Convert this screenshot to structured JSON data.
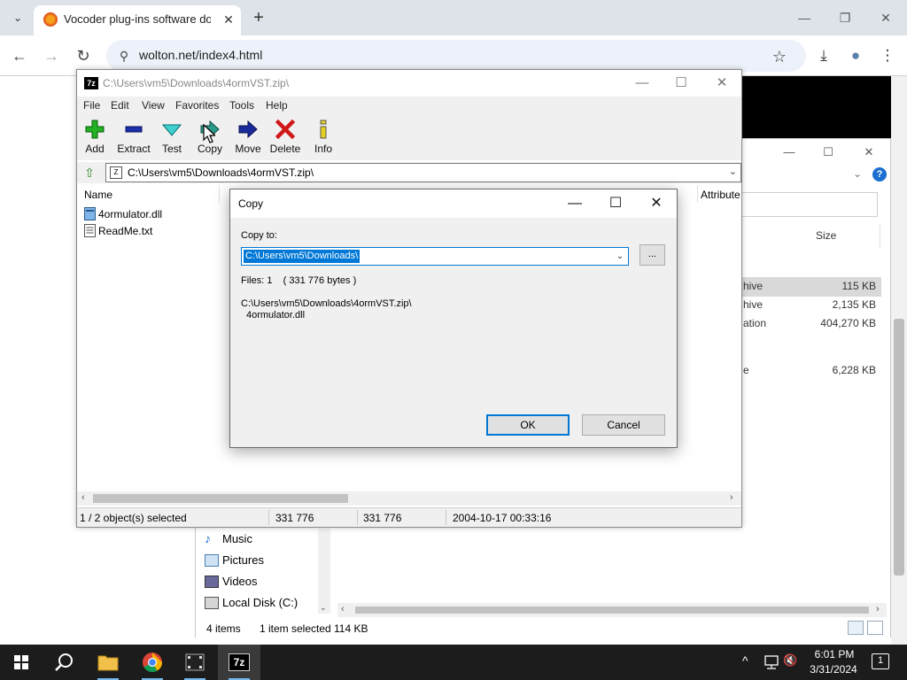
{
  "browser": {
    "tab_title": "Vocoder plug-ins software dow",
    "url": "wolton.net/index4.html",
    "icons": {
      "tab_search": "chevron-down-icon",
      "favicon": "site-favicon-icon",
      "close_tab": "close-icon",
      "new_tab": "plus-icon",
      "back": "back-arrow-icon",
      "forward": "forward-arrow-icon",
      "reload": "reload-icon",
      "site_info": "site-info-icon",
      "bookmark": "star-icon",
      "downloads": "download-icon",
      "profile": "profile-icon",
      "menu": "more-vert-icon"
    },
    "glyphs": {
      "tab_search": "⌄",
      "close_tab": "✕",
      "new_tab": "+",
      "minimize": "—",
      "maximize": "❐",
      "close": "✕",
      "back": "←",
      "forward": "→",
      "reload": "↻",
      "site_info": "⚲",
      "bookmark": "☆",
      "downloads": "⤓",
      "profile": "●",
      "menu": "⋮"
    }
  },
  "explorer": {
    "size_header": "Size",
    "rows": [
      {
        "type": "hive",
        "size": "115 KB"
      },
      {
        "type": "hive",
        "size": "2,135 KB"
      },
      {
        "type": "ation",
        "size": "404,270 KB"
      },
      {
        "type": "e",
        "size": "6,228 KB"
      }
    ],
    "nav_items": [
      {
        "label": "Music"
      },
      {
        "label": "Pictures"
      },
      {
        "label": "Videos"
      },
      {
        "label": "Local Disk (C:)"
      }
    ],
    "status": {
      "items": "4 items",
      "selected": "1 item selected",
      "size": "114 KB"
    }
  },
  "sevenzip": {
    "title": "C:\\Users\\vm5\\Downloads\\4ormVST.zip\\",
    "logo": "7z",
    "menu": [
      "File",
      "Edit",
      "View",
      "Favorites",
      "Tools",
      "Help"
    ],
    "toolbar": [
      {
        "label": "Add",
        "icon": "add-icon"
      },
      {
        "label": "Extract",
        "icon": "extract-icon"
      },
      {
        "label": "Test",
        "icon": "test-icon"
      },
      {
        "label": "Copy",
        "icon": "copy-icon"
      },
      {
        "label": "Move",
        "icon": "move-icon"
      },
      {
        "label": "Delete",
        "icon": "delete-icon"
      },
      {
        "label": "Info",
        "icon": "info-icon"
      }
    ],
    "address": "C:\\Users\\vm5\\Downloads\\4ormVST.zip\\",
    "columns": {
      "name": "Name",
      "attributes": "Attribute"
    },
    "files": [
      {
        "name": "4ormulator.dll",
        "icon": "dll-file-icon"
      },
      {
        "name": "ReadMe.txt",
        "icon": "text-file-icon"
      }
    ],
    "status": {
      "selected": "1 / 2 object(s) selected",
      "size": "331 776",
      "packed": "331 776",
      "modified": "2004-10-17 00:33:16"
    }
  },
  "copy_dialog": {
    "title": "Copy",
    "copy_to_label": "Copy to:",
    "path_value": "C:\\Users\\vm5\\Downloads\\",
    "browse_label": "...",
    "files_info": "Files: 1    ( 331 776 bytes )",
    "source_path": "C:\\Users\\vm5\\Downloads\\4ormVST.zip\\",
    "source_item": "4ormulator.dll",
    "ok_label": "OK",
    "cancel_label": "Cancel"
  },
  "taskbar": {
    "apps": [
      {
        "name": "start",
        "icon": "windows-start-icon"
      },
      {
        "name": "search",
        "icon": "search-icon"
      },
      {
        "name": "file-explorer",
        "icon": "folder-icon"
      },
      {
        "name": "chrome",
        "icon": "chrome-icon"
      },
      {
        "name": "media",
        "icon": "film-icon"
      },
      {
        "name": "7zip",
        "icon": "7zip-icon"
      }
    ],
    "tray_glyphs": {
      "chevron": "^",
      "volume": "🔇"
    },
    "time": "6:01 PM",
    "date": "3/31/2024",
    "notification_count": "1"
  },
  "colors": {
    "accent": "#0078d7",
    "chrome_frame": "#dee3ea",
    "taskbar": "#1c1c1c"
  }
}
